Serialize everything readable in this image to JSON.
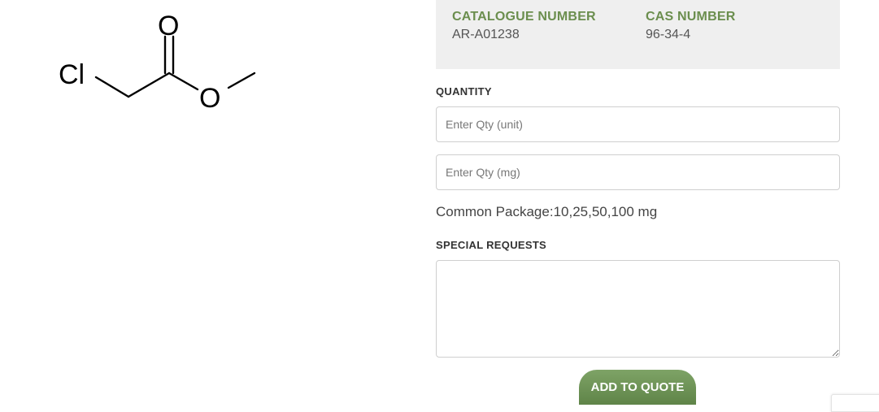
{
  "structure": {
    "atoms": {
      "cl": "Cl",
      "o_double": "O",
      "o_ester": "O"
    }
  },
  "info": {
    "catalogue_label": "CATALOGUE NUMBER",
    "catalogue_value": "AR-A01238",
    "cas_label": "CAS NUMBER",
    "cas_value": "96-34-4"
  },
  "quantity": {
    "label": "QUANTITY",
    "unit_placeholder": "Enter Qty (unit)",
    "mg_placeholder": "Enter Qty (mg)",
    "package_text": "Common Package:10,25,50,100 mg"
  },
  "requests": {
    "label": "SPECIAL REQUESTS"
  },
  "actions": {
    "add_to_quote": "ADD TO QUOTE"
  },
  "colors": {
    "accent": "#6b8e4e",
    "button_top": "#7ea366",
    "button_bottom": "#5f8448"
  }
}
